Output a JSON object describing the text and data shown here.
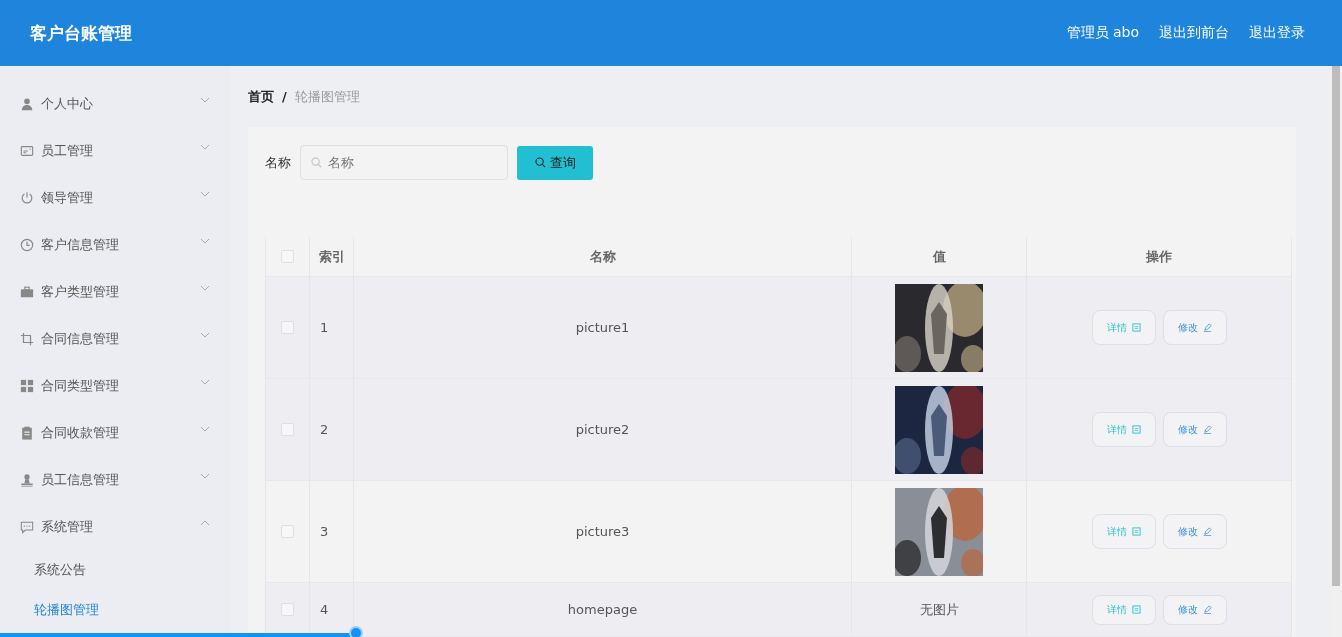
{
  "header": {
    "title": "客户台账管理",
    "links": [
      "管理员 abo",
      "退出到前台",
      "退出登录"
    ]
  },
  "sidebar": {
    "items": [
      {
        "label": "个人中心",
        "expanded": false
      },
      {
        "label": "员工管理",
        "expanded": false
      },
      {
        "label": "领导管理",
        "expanded": false
      },
      {
        "label": "客户信息管理",
        "expanded": false
      },
      {
        "label": "客户类型管理",
        "expanded": false
      },
      {
        "label": "合同信息管理",
        "expanded": false
      },
      {
        "label": "合同类型管理",
        "expanded": false
      },
      {
        "label": "合同收款管理",
        "expanded": false
      },
      {
        "label": "员工信息管理",
        "expanded": false
      },
      {
        "label": "系统管理",
        "expanded": true,
        "children": [
          {
            "label": "系统公告",
            "selected": false
          },
          {
            "label": "轮播图管理",
            "selected": true
          }
        ]
      }
    ]
  },
  "breadcrumb": {
    "items": [
      "首页",
      "轮播图管理"
    ],
    "separator": "/"
  },
  "search": {
    "label": "名称",
    "placeholder": "名称",
    "button": "查询"
  },
  "table": {
    "all_checked": false,
    "columns": [
      "索引",
      "名称",
      "值",
      "操作"
    ],
    "rows": [
      {
        "checked": false,
        "index": "1",
        "name": "picture1",
        "value": {
          "kind": "picture"
        },
        "actions": [
          "详情",
          "修改"
        ]
      },
      {
        "checked": false,
        "index": "2",
        "name": "picture2",
        "value": {
          "kind": "picture"
        },
        "actions": [
          "详情",
          "修改"
        ]
      },
      {
        "checked": false,
        "index": "3",
        "name": "picture3",
        "value": {
          "kind": "picture"
        },
        "actions": [
          "详情",
          "修改"
        ]
      },
      {
        "checked": false,
        "index": "4",
        "name": "homepage",
        "value": {
          "kind": "text",
          "text": "无图片"
        },
        "actions": [
          "详情",
          "修改"
        ]
      }
    ]
  },
  "video_progress": {
    "level": 0.265
  }
}
